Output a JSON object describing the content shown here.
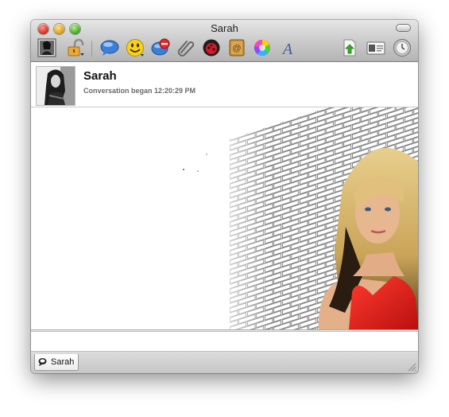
{
  "window": {
    "title": "Sarah"
  },
  "toolbar": {
    "items": [
      {
        "name": "contact-picture-button",
        "icon": "contact-picture-icon"
      },
      {
        "name": "encryption-button",
        "icon": "padlock-icon"
      },
      {
        "name": "chat-bubble-button",
        "icon": "speech-bubble-icon"
      },
      {
        "name": "emoticon-button",
        "icon": "smiley-face-icon"
      },
      {
        "name": "block-button",
        "icon": "block-icon"
      },
      {
        "name": "send-file-button",
        "icon": "paperclip-icon"
      },
      {
        "name": "info-button",
        "icon": "ladybug-icon"
      },
      {
        "name": "address-book-button",
        "icon": "address-book-icon"
      },
      {
        "name": "color-button",
        "icon": "color-wheel-icon"
      },
      {
        "name": "font-button",
        "icon": "font-letter-icon"
      },
      {
        "name": "upload-button",
        "icon": "upload-arrow-icon"
      },
      {
        "name": "contact-card-button",
        "icon": "contact-card-icon"
      },
      {
        "name": "history-button",
        "icon": "clock-icon"
      }
    ]
  },
  "header": {
    "contact_name": "Sarah",
    "status": "Conversation began 12:20:29 PM"
  },
  "tab": {
    "label": "Sarah",
    "icon": "chat-icon"
  },
  "colors": {
    "shirt_red": "#e0201f",
    "hair": "#d6b56a",
    "brick_gray": "#8c8c8c"
  }
}
